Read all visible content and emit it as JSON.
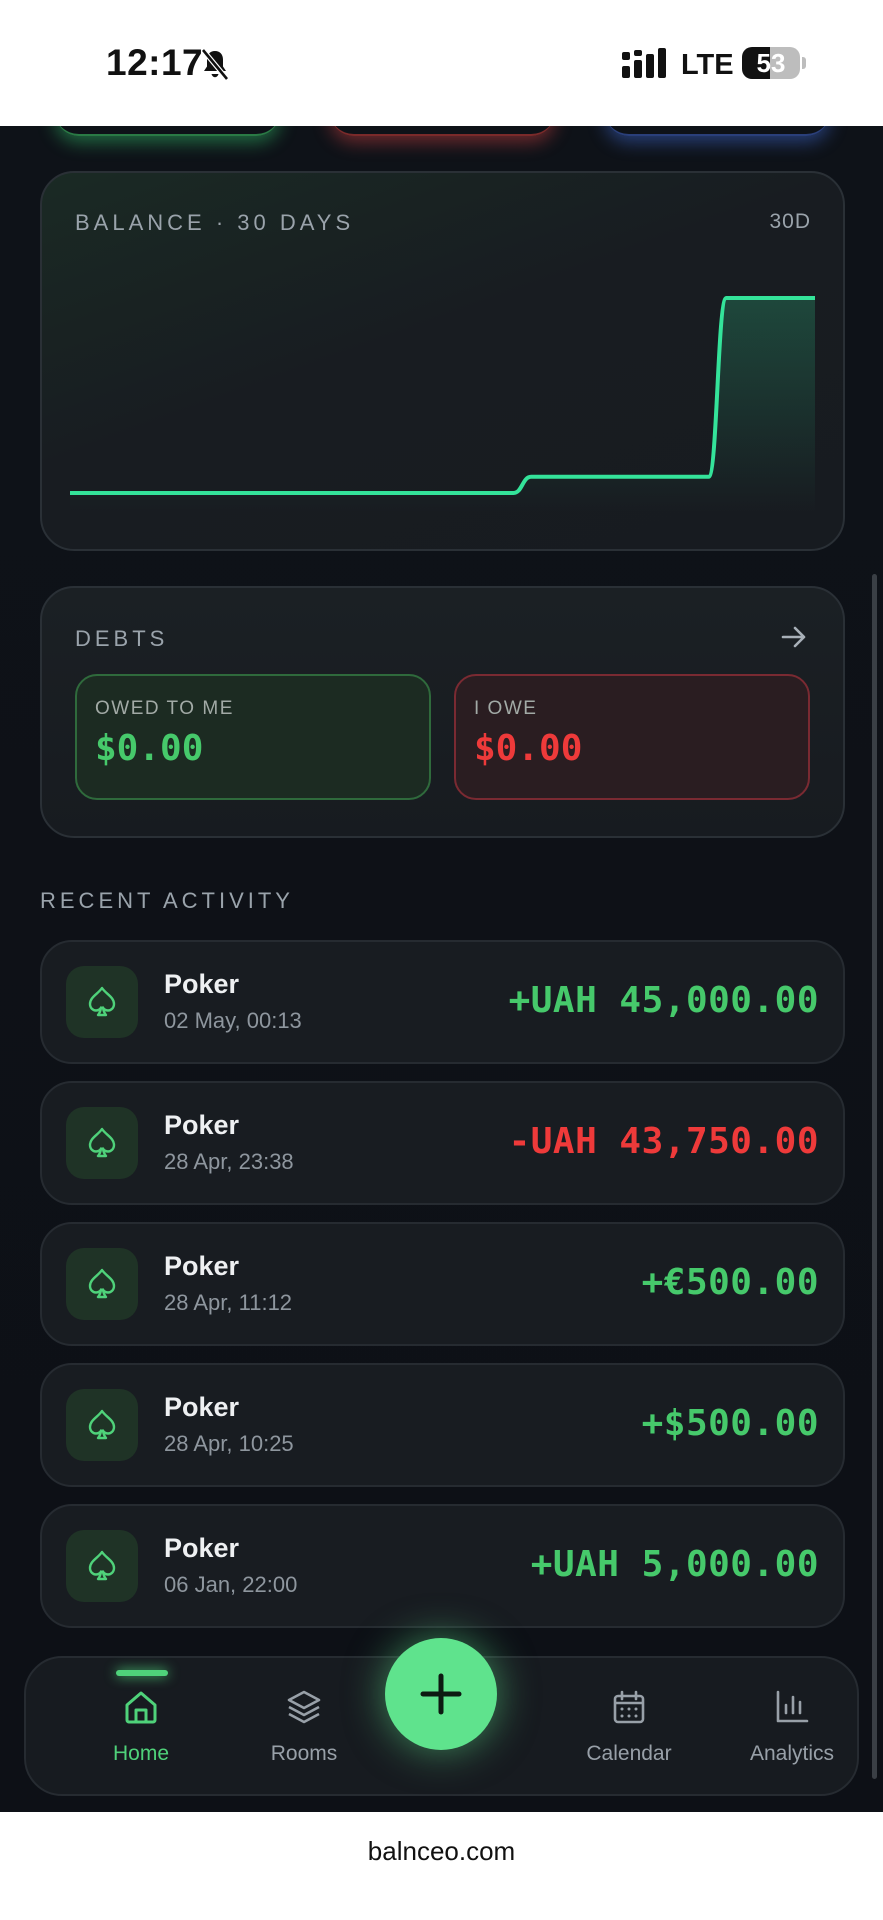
{
  "status_bar": {
    "time": "12:17",
    "network": "LTE",
    "battery": "53"
  },
  "balance_card": {
    "title": "BALANCE · 30 DAYS",
    "period": "30D",
    "line_color": "#34e39a"
  },
  "chart_data": {
    "type": "line",
    "title": "BALANCE · 30 DAYS",
    "series": [
      {
        "values": [
          0,
          0,
          0,
          0,
          0,
          0,
          0,
          0,
          0,
          0,
          0,
          0,
          0,
          0,
          0,
          0,
          0,
          0,
          0,
          0,
          0,
          0,
          0,
          0,
          0,
          0,
          1,
          1,
          1,
          1,
          1,
          1,
          1,
          1,
          1,
          1,
          1,
          12,
          12,
          12,
          12,
          12,
          12
        ]
      }
    ]
  },
  "debts": {
    "title": "DEBTS",
    "owed_to_me_label": "OWED TO ME",
    "owed_to_me_value": "$0.00",
    "i_owe_label": "I OWE",
    "i_owe_value": "$0.00"
  },
  "recent_activity": {
    "title": "RECENT ACTIVITY",
    "items": [
      {
        "name": "Poker",
        "date": "02 May, 00:13",
        "amount": "+UAH 45,000.00",
        "positive": true
      },
      {
        "name": "Poker",
        "date": "28 Apr, 23:38",
        "amount": "-UAH 43,750.00",
        "positive": false
      },
      {
        "name": "Poker",
        "date": "28 Apr, 11:12",
        "amount": "+€500.00",
        "positive": true
      },
      {
        "name": "Poker",
        "date": "28 Apr, 10:25",
        "amount": "+$500.00",
        "positive": true
      },
      {
        "name": "Poker",
        "date": "06 Jan, 22:00",
        "amount": "+UAH 5,000.00",
        "positive": true
      }
    ]
  },
  "nav": {
    "items": [
      {
        "label": "Home",
        "icon": "home-icon",
        "active": true
      },
      {
        "label": "Rooms",
        "icon": "layers-icon",
        "active": false
      },
      {
        "label": "Calendar",
        "icon": "calendar-icon",
        "active": false
      },
      {
        "label": "Analytics",
        "icon": "bar-chart-icon",
        "active": false
      }
    ],
    "fab_icon": "plus-icon"
  },
  "browser": {
    "url": "balnceo.com"
  },
  "colors": {
    "accent": "#4fd27a",
    "positive": "#46c96b",
    "negative": "#ee3a3a",
    "background": "#0e1116"
  }
}
